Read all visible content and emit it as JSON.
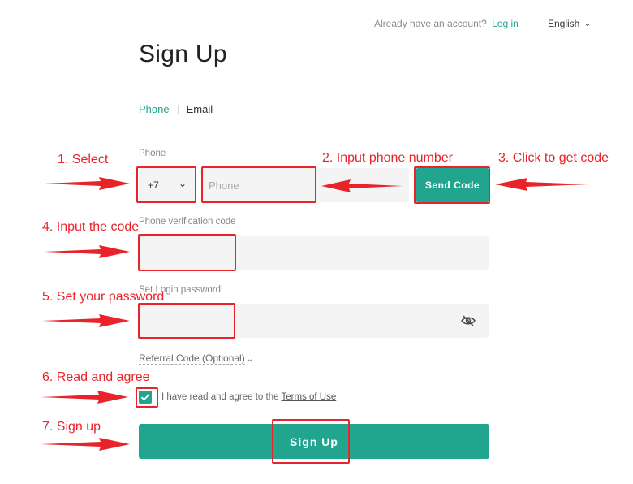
{
  "header": {
    "already_text": "Already have an account?",
    "login_link": "Log in",
    "language": "English"
  },
  "page_title": "Sign Up",
  "tabs": [
    {
      "label": "Phone",
      "active": true
    },
    {
      "label": "Email",
      "active": false
    }
  ],
  "form": {
    "phone_label": "Phone",
    "country_code": "+7",
    "phone_placeholder": "Phone",
    "send_code_label": "Send Code",
    "verification_label": "Phone verification code",
    "password_label": "Set Login password",
    "referral_label": "Referral Code (Optional)",
    "agree_text": "I have read and agree to the",
    "terms_link": "Terms of Use",
    "agreed": true,
    "signup_label": "Sign Up"
  },
  "annotations": [
    "1. Select",
    "2. Input phone number",
    "3. Click to get code",
    "4. Input the code",
    "5. Set your password",
    "6. Read and agree",
    "7. Sign up"
  ],
  "colors": {
    "accent": "#21a58f",
    "annotation": "#e8242a",
    "field_bg": "#f4f4f4"
  },
  "icons": [
    "chevron-down-icon",
    "eye-off-icon",
    "check-icon",
    "arrow-right-icon",
    "arrow-left-icon"
  ]
}
